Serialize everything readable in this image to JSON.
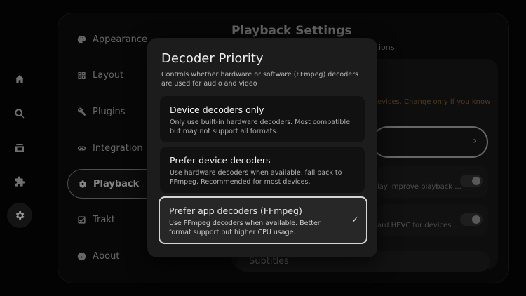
{
  "rail": {
    "items": [
      {
        "name": "home"
      },
      {
        "name": "search"
      },
      {
        "name": "library"
      },
      {
        "name": "addons"
      },
      {
        "name": "settings",
        "active": true
      }
    ]
  },
  "sidebar": {
    "items": [
      {
        "label": "Appearance",
        "icon": "palette-icon"
      },
      {
        "label": "Layout",
        "icon": "grid-icon"
      },
      {
        "label": "Plugins",
        "icon": "wrench-icon"
      },
      {
        "label": "Integration",
        "icon": "link-icon"
      },
      {
        "label": "Playback",
        "icon": "gear-icon",
        "active": true
      },
      {
        "label": "Trakt",
        "icon": "checkbox-icon"
      },
      {
        "label": "About",
        "icon": "info-icon"
      }
    ]
  },
  "settings": {
    "title": "Playback Settings",
    "subtitle_fragment": "ions",
    "warning_fragment": "evices. Change only if you know",
    "row1_desc_fragment": "lay improve playback ...",
    "row2_desc_fragment": "ard HEVC for devices ...",
    "subtitles_label": "Subtitles"
  },
  "dialog": {
    "title": "Decoder Priority",
    "subtitle": "Controls whether hardware or software (FFmpeg) decoders are used for audio and video",
    "options": [
      {
        "title": "Device decoders only",
        "desc": "Only use built-in hardware decoders. Most compatible but may not support all formats."
      },
      {
        "title": "Prefer device decoders",
        "desc": "Use hardware decoders when available, fall back to FFmpeg. Recommended for most devices."
      },
      {
        "title": "Prefer app decoders (FFmpeg)",
        "desc": "Use FFmpeg decoders when available. Better format support but higher CPU usage.",
        "selected": true
      }
    ],
    "check_glyph": "✓"
  },
  "colors": {
    "background": "#050505",
    "dialog": "#1c1c1c",
    "selected_border": "#d6d6d6",
    "warning": "#6f4f2b"
  }
}
